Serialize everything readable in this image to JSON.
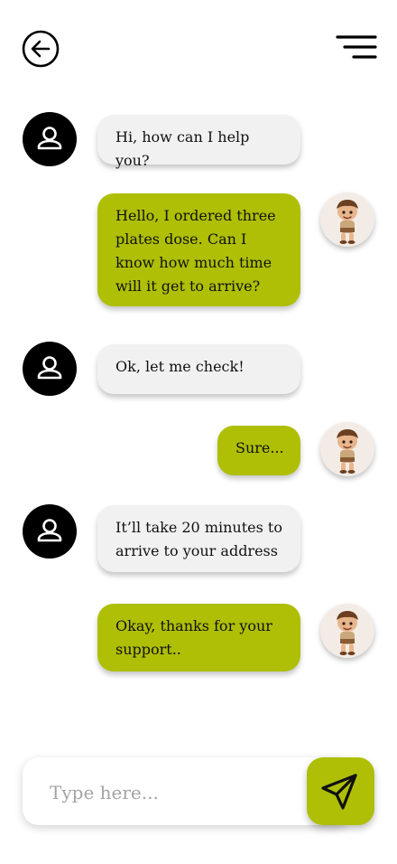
{
  "header": {
    "back_icon": "arrow-left-circle-icon",
    "menu_icon": "hamburger-menu-icon"
  },
  "colors": {
    "accent": "#aebf05",
    "bot_bubble": "#f1f1f1",
    "bot_avatar": "#000000",
    "background": "#ffffff"
  },
  "messages": [
    {
      "sender": "bot",
      "text": "Hi, how can I help you?"
    },
    {
      "sender": "user",
      "text": "Hello, I ordered three plates dose. Can I know how much time will it get to arrive?"
    },
    {
      "sender": "bot",
      "text": "Ok, let me check!"
    },
    {
      "sender": "user",
      "text": "Sure..."
    },
    {
      "sender": "bot",
      "text": "It’ll take 20 minutes to arrive to your address"
    },
    {
      "sender": "user",
      "text": "Okay, thanks for your support.."
    }
  ],
  "composer": {
    "placeholder": "Type here...",
    "value": "",
    "send_icon": "send-paper-plane-icon"
  }
}
